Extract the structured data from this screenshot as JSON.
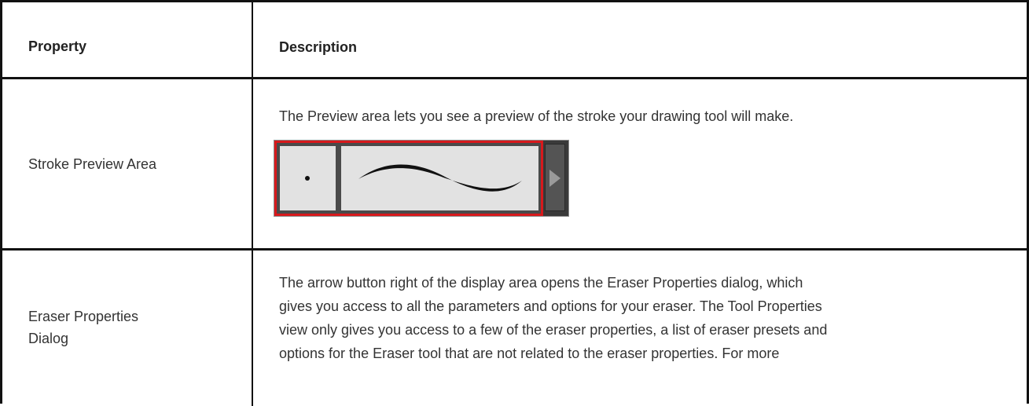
{
  "table": {
    "header": {
      "property": "Property",
      "description": "Description"
    },
    "rows": [
      {
        "property": "Stroke Preview Area",
        "description": "The Preview area lets you see a preview of the stroke your drawing tool will make."
      },
      {
        "property_lines": [
          "Eraser Properties",
          "Dialog"
        ],
        "description_lines": [
          "The arrow button right of the display area opens the Eraser Properties dialog, which",
          "gives you access to all the parameters and options for your eraser. The Tool Properties",
          "view only gives you access to a few of the eraser properties, a list of eraser presets and",
          "options for the Eraser tool that are not related to the eraser properties. For more"
        ]
      }
    ]
  },
  "preview_widget": {
    "icons": [
      "brush-size-dot-icon",
      "stroke-sample-icon",
      "arrow-right-icon"
    ],
    "highlight_color": "#d7191c"
  }
}
